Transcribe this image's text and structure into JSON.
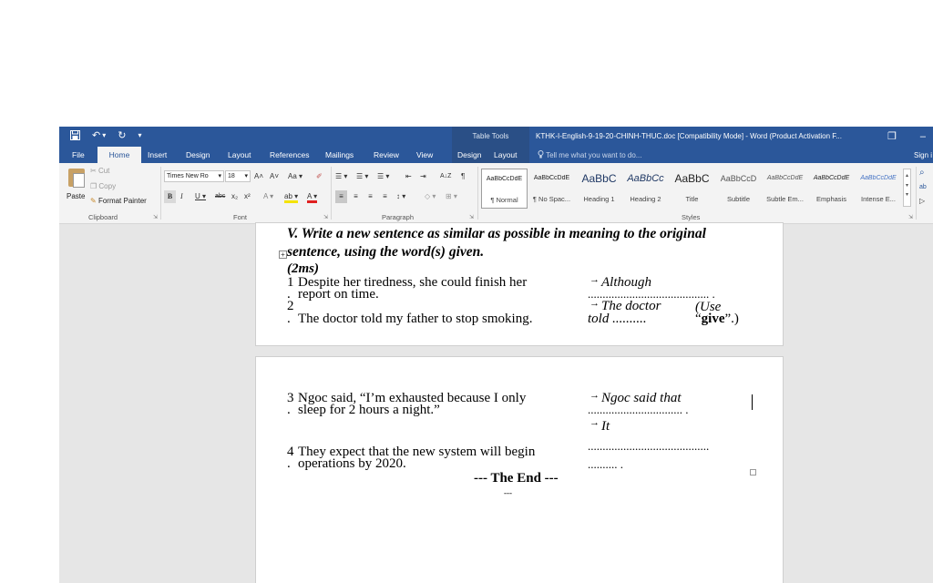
{
  "titlebar": {
    "qat": {
      "save_icon": "save-icon",
      "undo_glyph": "↶",
      "undo_dropdown": "▾",
      "redo_glyph": "↻",
      "customize_glyph": "▾"
    },
    "table_tools": "Table Tools",
    "title": "KTHK-I-English-9-19-20-CHINH-THUC.doc [Compatibility Mode] - Word (Product Activation F...",
    "ribbon_display_glyph": "❐",
    "minimize_glyph": "–"
  },
  "tabs": {
    "file": "File",
    "home": "Home",
    "insert": "Insert",
    "design": "Design",
    "layout": "Layout",
    "references": "References",
    "mailings": "Mailings",
    "review": "Review",
    "view": "View",
    "ctx_design": "Design",
    "ctx_layout": "Layout",
    "tell_me": "Tell me what you want to do...",
    "sign_in": "Sign i"
  },
  "clipboard": {
    "paste": "Paste",
    "cut": "Cut",
    "copy": "Copy",
    "format_painter": "Format Painter",
    "label": "Clipboard"
  },
  "font": {
    "name": "Times New Ro",
    "size": "18",
    "grow": "A˄",
    "shrink": "A˅",
    "change_case": "Aa ▾",
    "bold": "B",
    "italic": "I",
    "underline": "U ▾",
    "strike": "abc",
    "subscript": "x₂",
    "superscript": "x²",
    "text_effects": "A ▾",
    "highlight": "ab ▾",
    "font_color": "A ▾",
    "label": "Font"
  },
  "paragraph": {
    "bullets": "☰ ▾",
    "numbering": "☰ ▾",
    "multilevel": "☰ ▾",
    "decrease_indent": "⇤",
    "increase_indent": "⇥",
    "sort": "A↓Z",
    "show_marks": "¶",
    "align_left": "≡",
    "center": "≡",
    "align_right": "≡",
    "justify": "≡",
    "line_spacing": "↕ ▾",
    "shading": "◇ ▾",
    "borders": "⊞ ▾",
    "label": "Paragraph"
  },
  "styles": {
    "items": [
      {
        "preview": "AaBbCcDdE",
        "name": "¶ Normal"
      },
      {
        "preview": "AaBbCcDdE",
        "name": "¶ No Spac..."
      },
      {
        "preview": "AaBbC",
        "name": "Heading 1"
      },
      {
        "preview": "AaBbCc",
        "name": "Heading 2"
      },
      {
        "preview": "AaBbC",
        "name": "Title"
      },
      {
        "preview": "AaBbCcD",
        "name": "Subtitle"
      },
      {
        "preview": "AaBbCcDdE",
        "name": "Subtle Em..."
      },
      {
        "preview": "AaBbCcDdE",
        "name": "Emphasis"
      },
      {
        "preview": "AaBbCcDdE",
        "name": "Intense E..."
      }
    ],
    "label": "Styles"
  },
  "editing": {
    "find": "⌕",
    "replace": "ab",
    "select": "▷"
  },
  "document": {
    "section_title_line1": "V. Write a new sentence as similar as possible in meaning to the original",
    "section_title_line2": "sentence, using the word(s) given.",
    "marks": "(2ms)",
    "q1_num": "1",
    "q1_line1": "Despite her tiredness, she could finish her",
    "q1_dot": ".",
    "q1_line2": "report on time.",
    "q1_arrow": "→",
    "q1_cue": "Although",
    "q1_blank": "......................................... .",
    "q2_num": "2",
    "q2_dot": ".",
    "q2_line": "The doctor told my father to stop smoking.",
    "q2_arrow": "→",
    "q2_cue_1": "The doctor",
    "q2_cue_2": "told ..........",
    "q2_use": "(Use",
    "q2_word_open": "“",
    "q2_word": "give",
    "q2_word_close": "”.)",
    "q3_num": "3",
    "q3_line1": "Ngoc said, “I’m exhausted because I only",
    "q3_dot": ".",
    "q3_line2": "sleep for 2 hours a night.”",
    "q3_arrow": "→",
    "q3_cue": "Ngoc said that",
    "q3_blank": "................................ .",
    "q4_arrow": "→",
    "q4_cue": "It",
    "q4_num": "4",
    "q4_line1": "They expect that the new system will begin",
    "q4_dot": ".",
    "q4_line2": "operations by 2020.",
    "q4_blank1": ".........................................",
    "q4_blank2": ".......... .",
    "the_end": "--- The End ---",
    "small_dashes": "---"
  }
}
